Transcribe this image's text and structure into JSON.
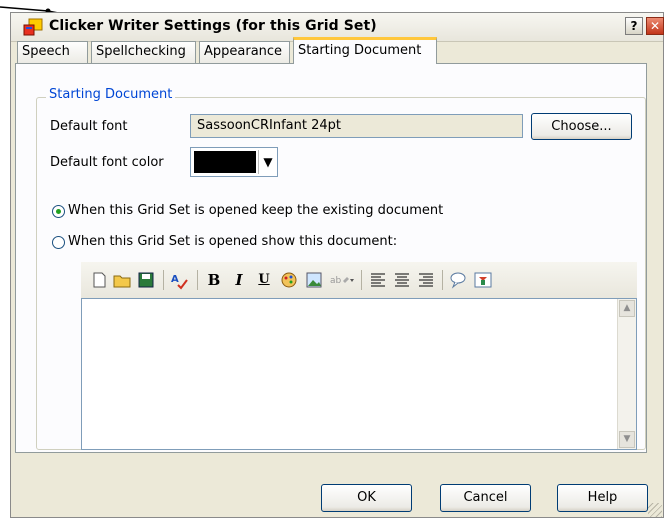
{
  "window": {
    "title": "Clicker Writer Settings (for this Grid Set)",
    "help_label": "?",
    "close_label": "✕"
  },
  "tabs": [
    {
      "label": "Speech"
    },
    {
      "label": "Spellchecking"
    },
    {
      "label": "Appearance"
    },
    {
      "label": "Starting Document",
      "active": true
    }
  ],
  "group": {
    "legend": "Starting Document",
    "default_font_label": "Default font",
    "default_font_value": "SassoonCRInfant 24pt",
    "choose_label": "Choose...",
    "font_color_label": "Default font color",
    "font_color_value": "#000000",
    "dropdown_arrow": "▼",
    "radio_keep_label": "When this Grid Set is opened keep the existing document",
    "radio_keep_selected": true,
    "radio_show_label": "When this Grid Set is opened show this document:",
    "radio_show_selected": false
  },
  "toolbar": {
    "bold": "B",
    "italic": "I",
    "underline": "U",
    "icons": [
      "new-document-icon",
      "open-folder-icon",
      "save-icon",
      "spellcheck-icon",
      "bold-icon",
      "italic-icon",
      "underline-icon",
      "paint-icon",
      "insert-picture-icon",
      "highlight-icon",
      "align-left-icon",
      "align-center-icon",
      "align-right-icon",
      "speech-bubble-icon",
      "speak-icon"
    ]
  },
  "buttons": {
    "ok": "OK",
    "cancel": "Cancel",
    "help": "Help"
  },
  "colors": {
    "dialog_bg": "#ECE9D8",
    "tab_highlight": "#FFC73C",
    "group_legend": "#0046D5",
    "radio_dot": "#21A121"
  }
}
